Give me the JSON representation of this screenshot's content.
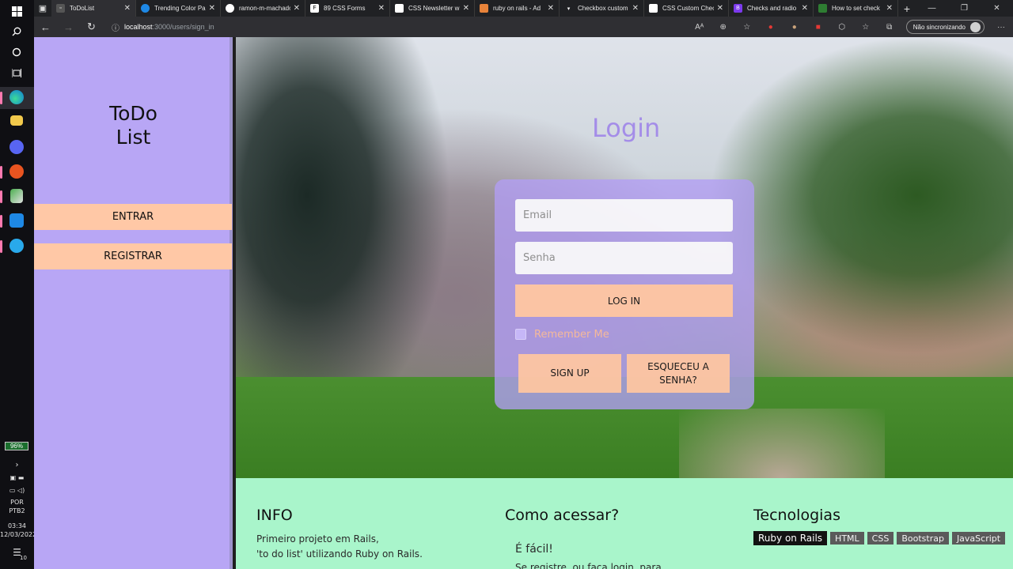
{
  "taskbar": {
    "battery": "96%",
    "language_1": "POR",
    "language_2": "PTB2",
    "time": "03:34",
    "date": "12/03/2022",
    "notifications": "10"
  },
  "browser": {
    "tabs": [
      {
        "title": "ToDoList",
        "color": "#3a3a3a"
      },
      {
        "title": "Trending Color Pa",
        "color": "#1e88e5"
      },
      {
        "title": "ramon-m-machado",
        "color": "#333333"
      },
      {
        "title": "89 CSS Forms",
        "color": "#333333"
      },
      {
        "title": "CSS Newsletter w",
        "color": "#333333"
      },
      {
        "title": "ruby on rails - Ad",
        "color": "#e8833a"
      },
      {
        "title": "Checkbox custom",
        "color": "#333333"
      },
      {
        "title": "CSS Custom Chec",
        "color": "#333333"
      },
      {
        "title": "Checks and radio",
        "color": "#7c3aed"
      },
      {
        "title": "How to set check",
        "color": "#2e7d32"
      }
    ],
    "address_host": "localhost",
    "address_path": ":3000/users/sign_in",
    "sync_label": "Não sincronizando"
  },
  "sidebar": {
    "brand_line1": "ToDo",
    "brand_line2": "List",
    "enter_label": "ENTRAR",
    "register_label": "REGISTRAR"
  },
  "login": {
    "title": "Login",
    "email_placeholder": "Email",
    "password_placeholder": "Senha",
    "login_label": "LOG IN",
    "remember_label": "Remember Me",
    "signup_label": "SIGN UP",
    "forgot_line1": "ESQUECEU A",
    "forgot_line2": "SENHA?"
  },
  "footer": {
    "info_title": "INFO",
    "info_line1": "Primeiro projeto em Rails,",
    "info_line2": "'to do list' utilizando Ruby on Rails.",
    "access_title": "Como acessar?",
    "access_line1": "É fácil!",
    "access_line2": "Se registre, ou faça login, para",
    "tech_title": "Tecnologias",
    "tech_tags": [
      "Ruby on Rails",
      "HTML",
      "CSS",
      "Bootstrap",
      "JavaScript"
    ]
  },
  "colors": {
    "sidebar": "#b8a6f5",
    "button": "#ffc8a6",
    "footer": "#a9f5cb",
    "login_title": "#a48de8"
  }
}
